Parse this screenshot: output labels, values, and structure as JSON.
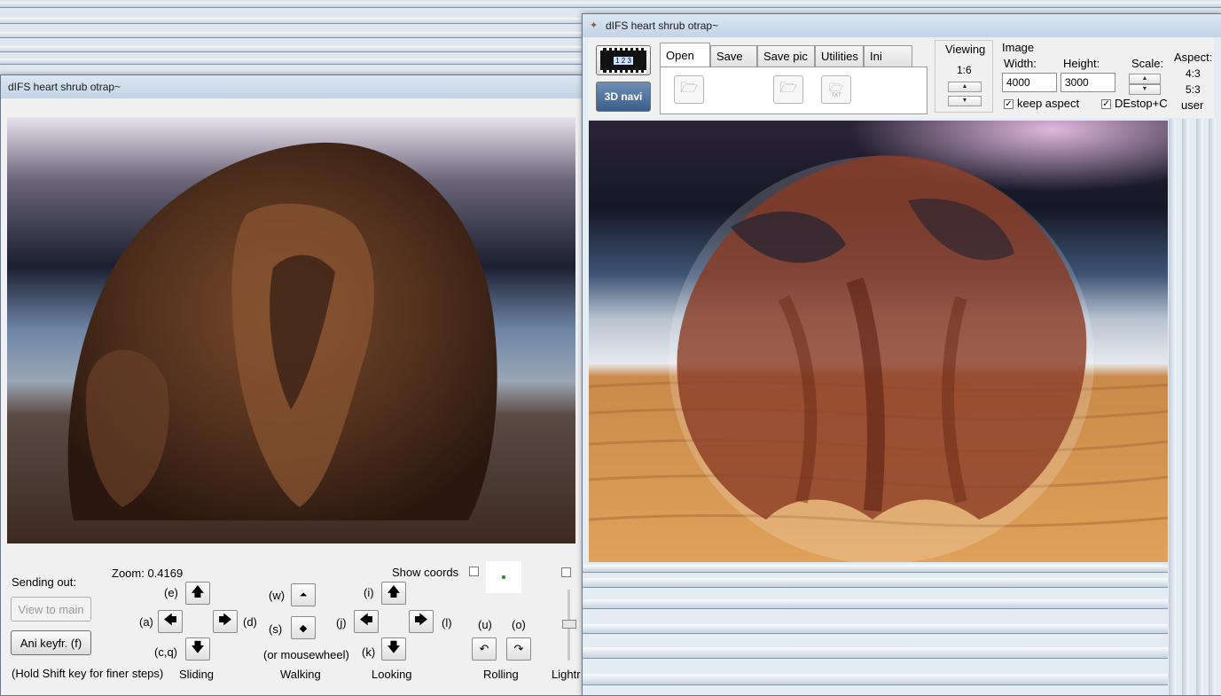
{
  "left_window": {
    "title": "dIFS heart shrub otrap~",
    "zoom_label": "Zoom: 0.4169",
    "show_coords_label": "Show coords",
    "sending_out_label": "Sending out:",
    "view_to_main_label": "View to main",
    "ani_keyfr_label": "Ani keyfr. (f)",
    "shift_hint": "(Hold Shift key for finer steps)",
    "keys": {
      "e": "(e)",
      "a": "(a)",
      "d": "(d)",
      "cq": "(c,q)",
      "w": "(w)",
      "s": "(s)",
      "mousewheel": "(or mousewheel)",
      "i": "(i)",
      "j": "(j)",
      "l": "(l)",
      "k": "(k)",
      "u": "(u)",
      "o": "(o)"
    },
    "group_labels": {
      "sliding": "Sliding",
      "walking": "Walking",
      "looking": "Looking",
      "rolling": "Rolling",
      "light": "Lightr"
    }
  },
  "right_window": {
    "title": "dIFS heart shrub otrap~",
    "navi_label": "3D navi",
    "film_label": "1 2 3",
    "tabs": [
      "Open",
      "Save",
      "Save pic",
      "Utilities",
      "Ini"
    ],
    "active_tab": "Open",
    "viewing_label": "Viewing",
    "viewing_value": "1:6",
    "image_label": "Image",
    "width_label": "Width:",
    "width_value": "4000",
    "height_label": "Height:",
    "height_value": "3000",
    "scale_label": "Scale:",
    "aspect_label": "Aspect:",
    "aspect_options": [
      "4:3",
      "5:3",
      "user"
    ],
    "keep_aspect_label": "keep aspect",
    "keep_aspect_checked": true,
    "destop_label": "DEstop+C",
    "destop_checked": true,
    "txt_icon_label": "TXT"
  },
  "colors": {
    "titlebar": "#c3d4e6",
    "panel": "#f0f0f0",
    "accent_dot": "#1a8a1a"
  }
}
